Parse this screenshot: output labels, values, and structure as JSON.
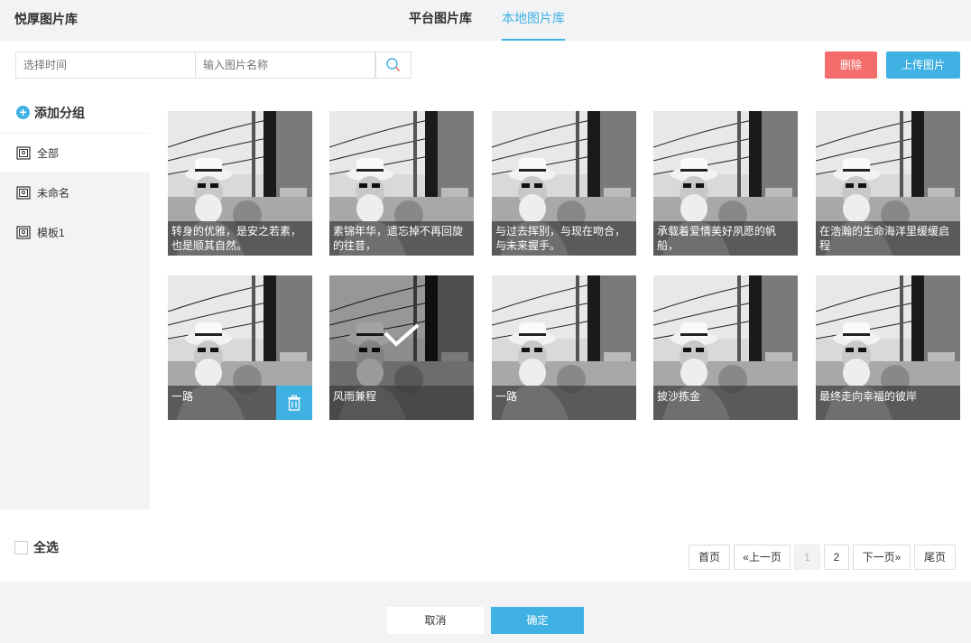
{
  "header": {
    "app_title": "悦厚图片库",
    "tabs": [
      {
        "label": "平台图片库"
      },
      {
        "label": "本地图片库"
      }
    ]
  },
  "toolbar": {
    "time_placeholder": "选择时间",
    "name_placeholder": "输入图片名称",
    "delete_label": "删除",
    "upload_label": "上传图片"
  },
  "sidebar": {
    "add_group_label": "添加分组",
    "items": [
      {
        "label": "全部"
      },
      {
        "label": "未命名"
      },
      {
        "label": "模板1"
      }
    ]
  },
  "images": [
    {
      "caption": "转身的优雅，是安之若素，也是顺其自然。"
    },
    {
      "caption": "素锦年华，遗忘掉不再回旋的往昔，"
    },
    {
      "caption": "与过去挥别，与现在吻合，与未来握手。"
    },
    {
      "caption": "承载着爱情美好夙愿的帆船，"
    },
    {
      "caption": "在浩瀚的生命海洋里缓缓启程"
    },
    {
      "caption": "一路"
    },
    {
      "caption": "风雨兼程",
      "selected": true
    },
    {
      "caption": "一路"
    },
    {
      "caption": "披沙拣金"
    },
    {
      "caption": "最终走向幸福的彼岸"
    }
  ],
  "footer": {
    "select_all_label": "全选",
    "pagination": {
      "first": "首页",
      "prev": "«上一页",
      "pages": [
        "1",
        "2"
      ],
      "current": 1,
      "next": "下一页»",
      "last": "尾页"
    },
    "cancel_label": "取消",
    "confirm_label": "确定"
  },
  "colors": {
    "accent": "#3fb1e3",
    "danger": "#f56c6c"
  }
}
